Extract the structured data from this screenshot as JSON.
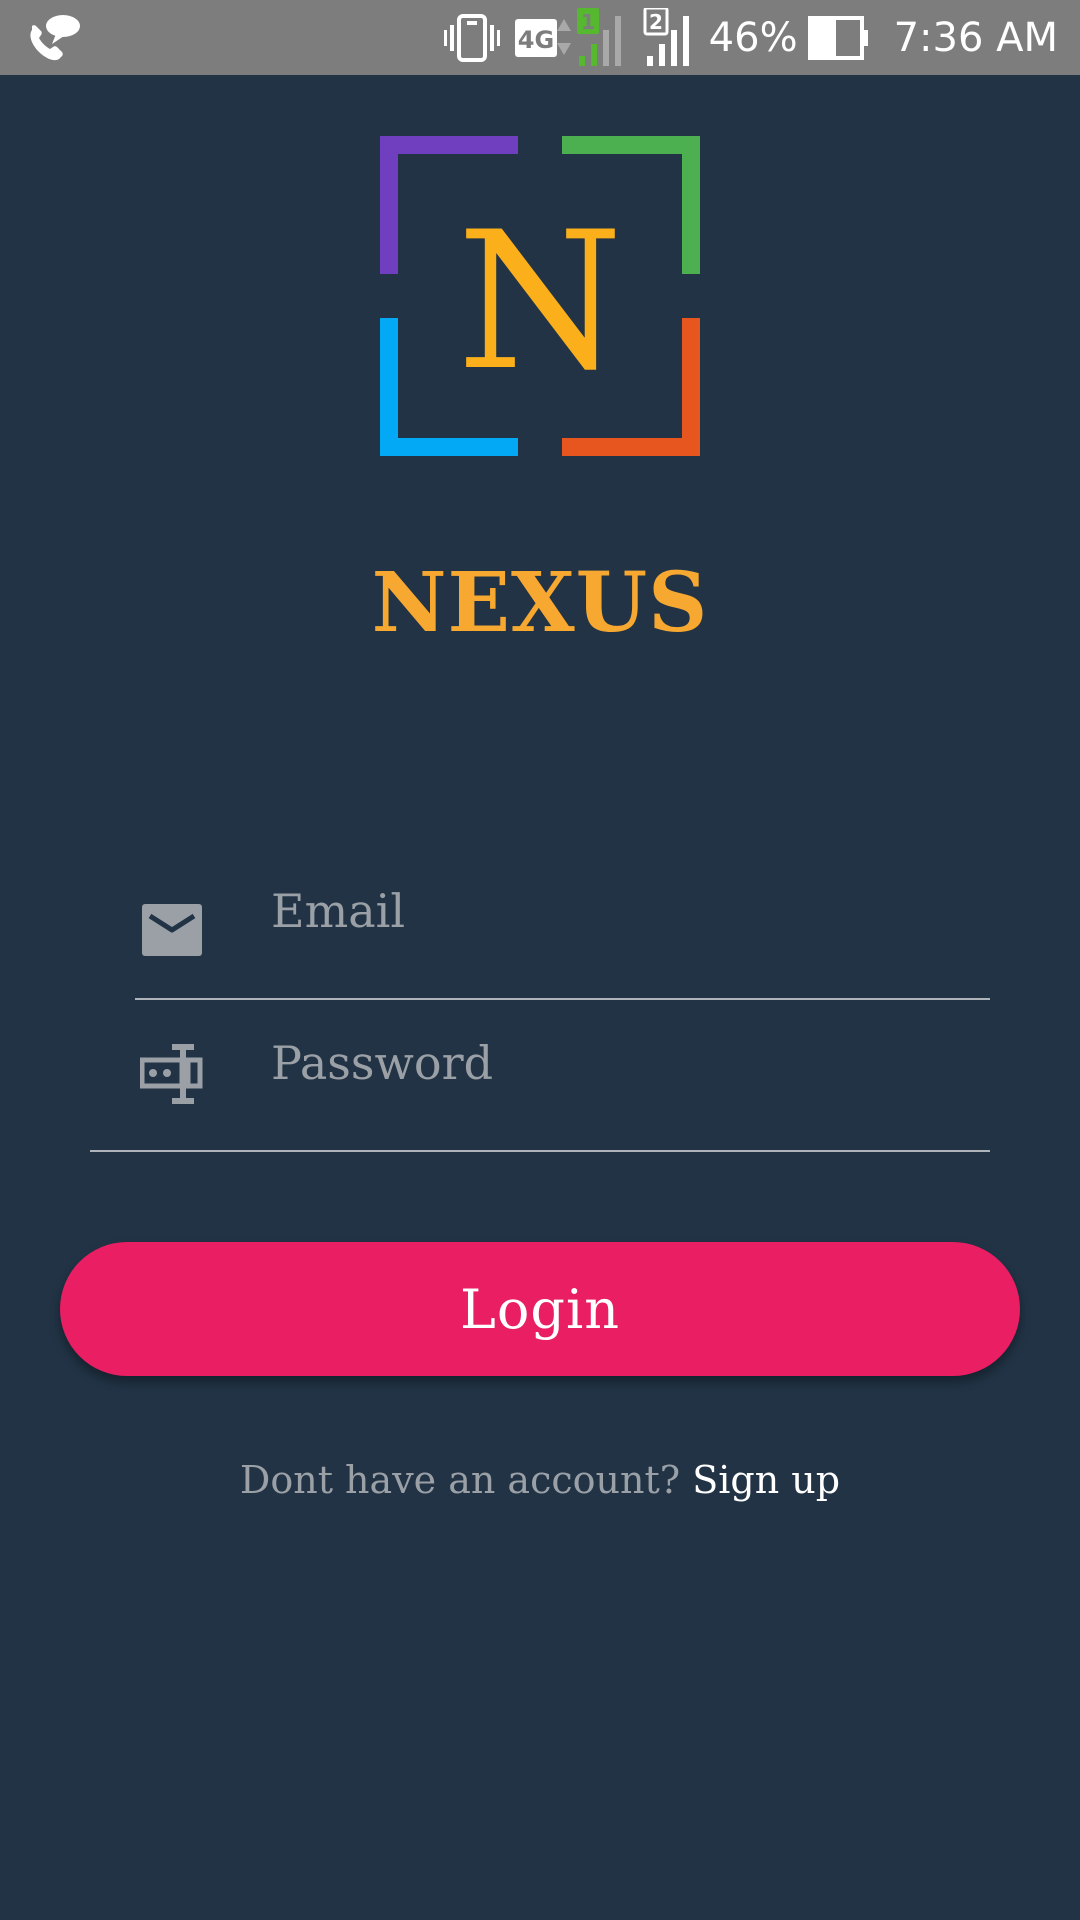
{
  "status_bar": {
    "icons": [
      "call-bubble-icon",
      "vibrate-icon",
      "4g-icon",
      "sim1-signal-icon",
      "sim2-signal-icon",
      "battery-icon"
    ],
    "network_label": "4G",
    "sim1_label": "1",
    "sim2_label": "2",
    "battery_percent": "46%",
    "time": "7:36 AM"
  },
  "logo": {
    "letter": "N",
    "colors": {
      "top_left": "#6f3fbf",
      "top_right": "#4caf50",
      "bottom_left": "#03a9f4",
      "bottom_right": "#e8561f",
      "letter": "#fbb01b"
    }
  },
  "app_name": "NEXUS",
  "form": {
    "email": {
      "placeholder": "Email",
      "icon": "envelope-icon"
    },
    "password": {
      "placeholder": "Password",
      "icon": "password-key-icon"
    },
    "login_label": "Login"
  },
  "signup": {
    "prompt": "Dont have an account?",
    "link": "Sign up"
  },
  "colors": {
    "background": "#213345",
    "status_bar": "#7d7d7d",
    "accent": "#e91e63",
    "brand_orange": "#f7a830",
    "placeholder": "#9aa0a6"
  }
}
